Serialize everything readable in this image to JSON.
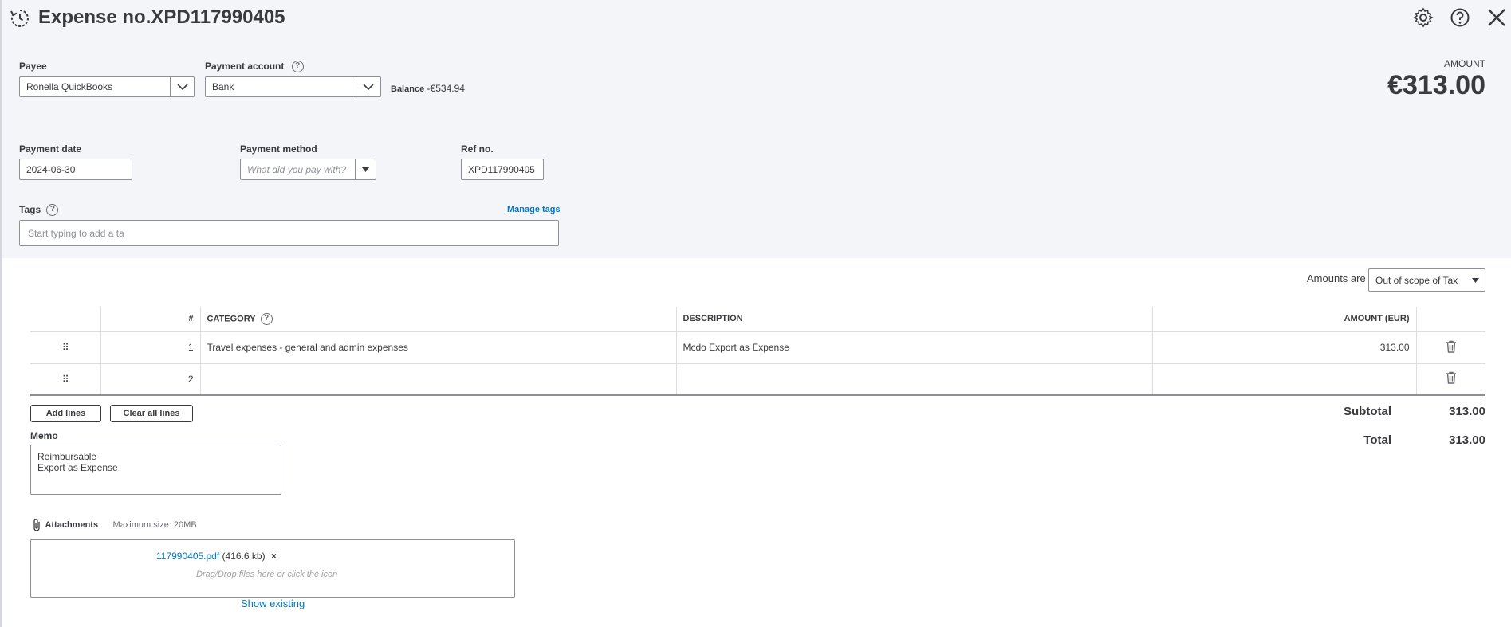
{
  "header": {
    "title": "Expense no.XPD117990405",
    "icons": [
      "history-icon",
      "gear-icon",
      "help-icon",
      "close-icon"
    ]
  },
  "payee": {
    "label": "Payee",
    "value": "Ronella QuickBooks"
  },
  "payment_account": {
    "label": "Payment account",
    "value": "Bank",
    "balance_label": "Balance",
    "balance_value": "-€534.94"
  },
  "amount": {
    "label": "AMOUNT",
    "value": "€313.00"
  },
  "payment_date": {
    "label": "Payment date",
    "value": "2024-06-30"
  },
  "payment_method": {
    "label": "Payment method",
    "placeholder": "What did you pay with?"
  },
  "ref_no": {
    "label": "Ref no.",
    "value": "XPD117990405"
  },
  "tags": {
    "label": "Tags",
    "manage_link": "Manage tags",
    "placeholder": "Start typing to add a ta"
  },
  "amounts_are": {
    "label": "Amounts are",
    "value": "Out of scope of Tax"
  },
  "table": {
    "headers": {
      "num": "#",
      "category": "CATEGORY",
      "description": "DESCRIPTION",
      "amount": "AMOUNT (EUR)"
    },
    "rows": [
      {
        "num": "1",
        "category": "Travel expenses - general and admin expenses",
        "description": "Mcdo Export as Expense",
        "amount": "313.00"
      },
      {
        "num": "2",
        "category": "",
        "description": "",
        "amount": ""
      }
    ]
  },
  "buttons": {
    "add_lines": "Add lines",
    "clear_all_lines": "Clear all lines"
  },
  "totals": {
    "subtotal_label": "Subtotal",
    "subtotal_value": "313.00",
    "total_label": "Total",
    "total_value": "313.00"
  },
  "memo": {
    "label": "Memo",
    "line1": "Reimbursable",
    "line2": "Export as Expense"
  },
  "attachments": {
    "label": "Attachments",
    "max_size": "Maximum size: 20MB",
    "file_name": "117990405.pdf",
    "file_size": "(416.6 kb)",
    "drop_hint": "Drag/Drop files here or click the icon",
    "show_existing": "Show existing"
  },
  "colors": {
    "header_bg": "#f4f5f8",
    "link": "#0077c5",
    "text": "#393a3d"
  }
}
